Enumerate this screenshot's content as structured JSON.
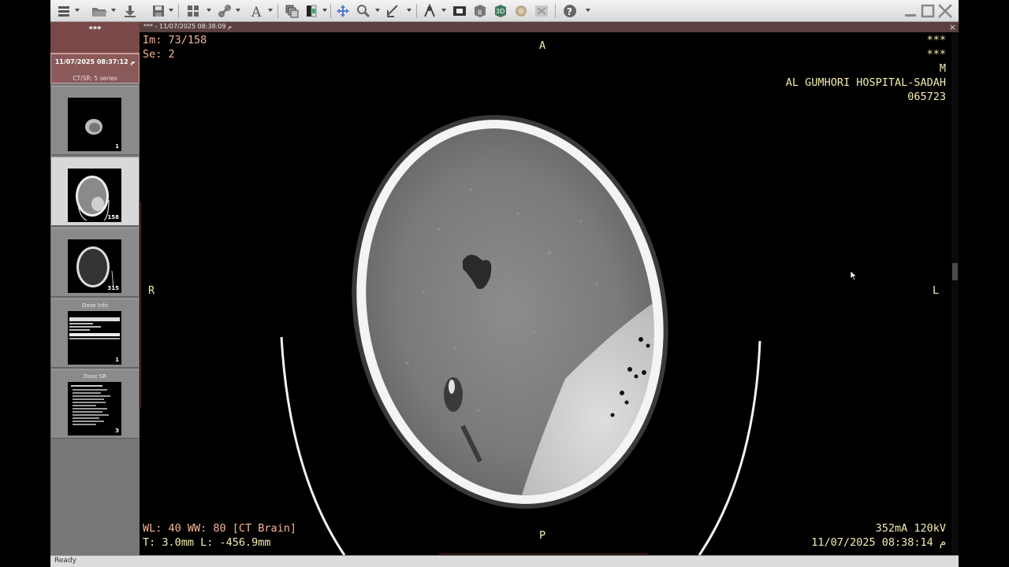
{
  "toolbar": {
    "icons": [
      "menu-icon",
      "open-folder-icon",
      "download-icon",
      "save-icon",
      "layout-icon",
      "link-icon",
      "text-annotation-icon",
      "stack-icon",
      "window-level-icon",
      "pan-icon",
      "zoom-icon",
      "measure-icon",
      "mpr-icon",
      "film-icon",
      "volume-render-icon",
      "3d-icon",
      "fusion-icon",
      "compare-icon",
      "help-icon"
    ],
    "window_buttons": [
      "minimize",
      "maximize",
      "close"
    ]
  },
  "sidebar": {
    "patient_name": "***",
    "study_date": "11/07/2025 08:37:12 م",
    "study_description": "CT/SR: 5 series",
    "series": [
      {
        "label": "",
        "count": "1"
      },
      {
        "label": "",
        "count": "158",
        "selected": true
      },
      {
        "label": "",
        "count": "315"
      },
      {
        "label": "Dose Info",
        "count": "1"
      },
      {
        "label": "Dose SR",
        "count": "3"
      }
    ]
  },
  "viewer": {
    "title": "*** - 11/07/2025 08:38:09 م",
    "close": "×",
    "overlay": {
      "image_index": "Im: 73/158",
      "series_number": "Se: 2",
      "top_right": [
        "***",
        "***",
        "M",
        "AL GUMHORI HOSPITAL-SADAH",
        "065723"
      ],
      "orient_top": "A",
      "orient_bottom": "P",
      "orient_left": "R",
      "orient_right": "L",
      "window_level": "WL: 40 WW: 80 [CT Brain]",
      "thickness_location": "T: 3.0mm L: -456.9mm",
      "exposure": "352mA 120kV",
      "acquisition_datetime": "11/07/2025 08:38:14 م"
    }
  },
  "status": {
    "text": "Ready"
  },
  "colors": {
    "overlay_salmon": "#f6b59a",
    "overlay_yellow": "#f3ecb0",
    "panel_header": "#7a4848"
  }
}
